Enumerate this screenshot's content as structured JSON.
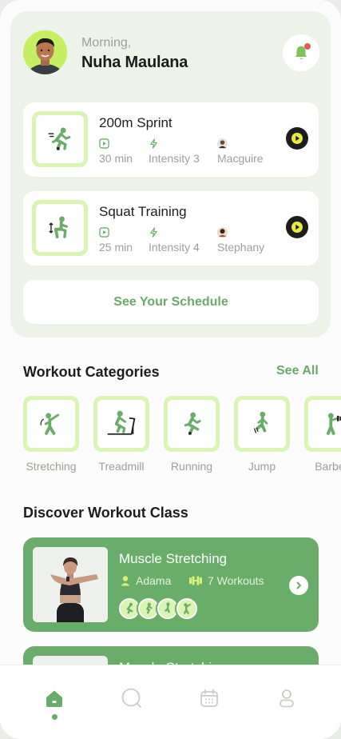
{
  "header": {
    "greeting": "Morning,",
    "user_name": "Nuha Maulana"
  },
  "upcoming": [
    {
      "title": "200m Sprint",
      "duration": "30 min",
      "intensity": "Intensity 3",
      "trainer": "Macguire",
      "icon": "sprint-icon"
    },
    {
      "title": "Squat Training",
      "duration": "25 min",
      "intensity": "Intensity 4",
      "trainer": "Stephany",
      "icon": "squat-icon"
    }
  ],
  "schedule_button": "See Your Schedule",
  "categories_section": {
    "title": "Workout Categories",
    "see_all": "See All",
    "items": [
      {
        "label": "Stretching",
        "icon": "stretching-icon"
      },
      {
        "label": "Treadmill",
        "icon": "treadmill-icon"
      },
      {
        "label": "Running",
        "icon": "running-icon"
      },
      {
        "label": "Jump",
        "icon": "jump-icon"
      },
      {
        "label": "Barbell",
        "icon": "barbell-icon"
      }
    ]
  },
  "discover_section": {
    "title": "Discover Workout Class",
    "classes": [
      {
        "title": "Muscle Stretching",
        "trainer": "Adama",
        "workouts": "7 Workouts"
      },
      {
        "title": "Muscle Stretching"
      }
    ]
  },
  "nav": [
    "home-icon",
    "search-icon",
    "calendar-icon",
    "profile-icon"
  ],
  "colors": {
    "accent_green": "#6aad6a",
    "tile_lime": "#d9f4b3",
    "avatar_bg": "#c6ee63",
    "notification": "#e85a4f",
    "hero_bg": "#eef3ea"
  }
}
